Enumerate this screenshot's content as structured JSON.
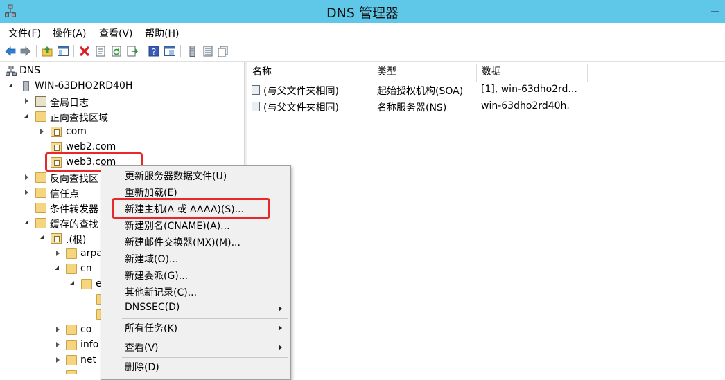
{
  "window": {
    "title": "DNS 管理器"
  },
  "menu": [
    "文件(F)",
    "操作(A)",
    "查看(V)",
    "帮助(H)"
  ],
  "toolbar": {
    "icons": [
      "back-arrow-icon",
      "forward-arrow-icon",
      "up-folder-icon",
      "show-hide-tree-icon",
      "delete-icon",
      "properties-icon",
      "refresh-icon",
      "export-list-icon",
      "help-icon",
      "console-icon",
      "server-icon",
      "list-icon",
      "records-icon"
    ],
    "colors": {
      "delete": "#d81f26",
      "arrow": "#2a7fd4",
      "help": "#3a5bb5"
    }
  },
  "tree": {
    "root": "DNS",
    "server": "WIN-63DHO2RD40H",
    "global_log": "全局日志",
    "forward_zones": "正向查找区域",
    "zone_com": "com",
    "zone_web2": "web2.com",
    "zone_web3": "web3.com",
    "reverse_zones": "反向查找区",
    "trust_points": "信任点",
    "cond_forwarders": "条件转发器",
    "cached_lookups": "缓存的查找",
    "root_hint": ".(根)",
    "arpa": "arpa",
    "cn": "cn",
    "cn_child": "e",
    "co": "co",
    "info": "info",
    "net": "net"
  },
  "list": {
    "columns": [
      "名称",
      "类型",
      "数据"
    ],
    "rows": [
      {
        "name": "(与父文件夹相同)",
        "type": "起始授权机构(SOA)",
        "data": "[1], win-63dho2rd..."
      },
      {
        "name": "(与父文件夹相同)",
        "type": "名称服务器(NS)",
        "data": "win-63dho2rd40h."
      }
    ]
  },
  "context_menu": {
    "items": [
      "更新服务器数据文件(U)",
      "重新加载(E)",
      "新建主机(A 或 AAAA)(S)...",
      "新建别名(CNAME)(A)...",
      "新建邮件交换器(MX)(M)...",
      "新建域(O)...",
      "新建委派(G)...",
      "其他新记录(C)...",
      "DNSSEC(D)",
      "所有任务(K)",
      "查看(V)",
      "删除(D)"
    ]
  },
  "highlight_color": "#e8282a"
}
